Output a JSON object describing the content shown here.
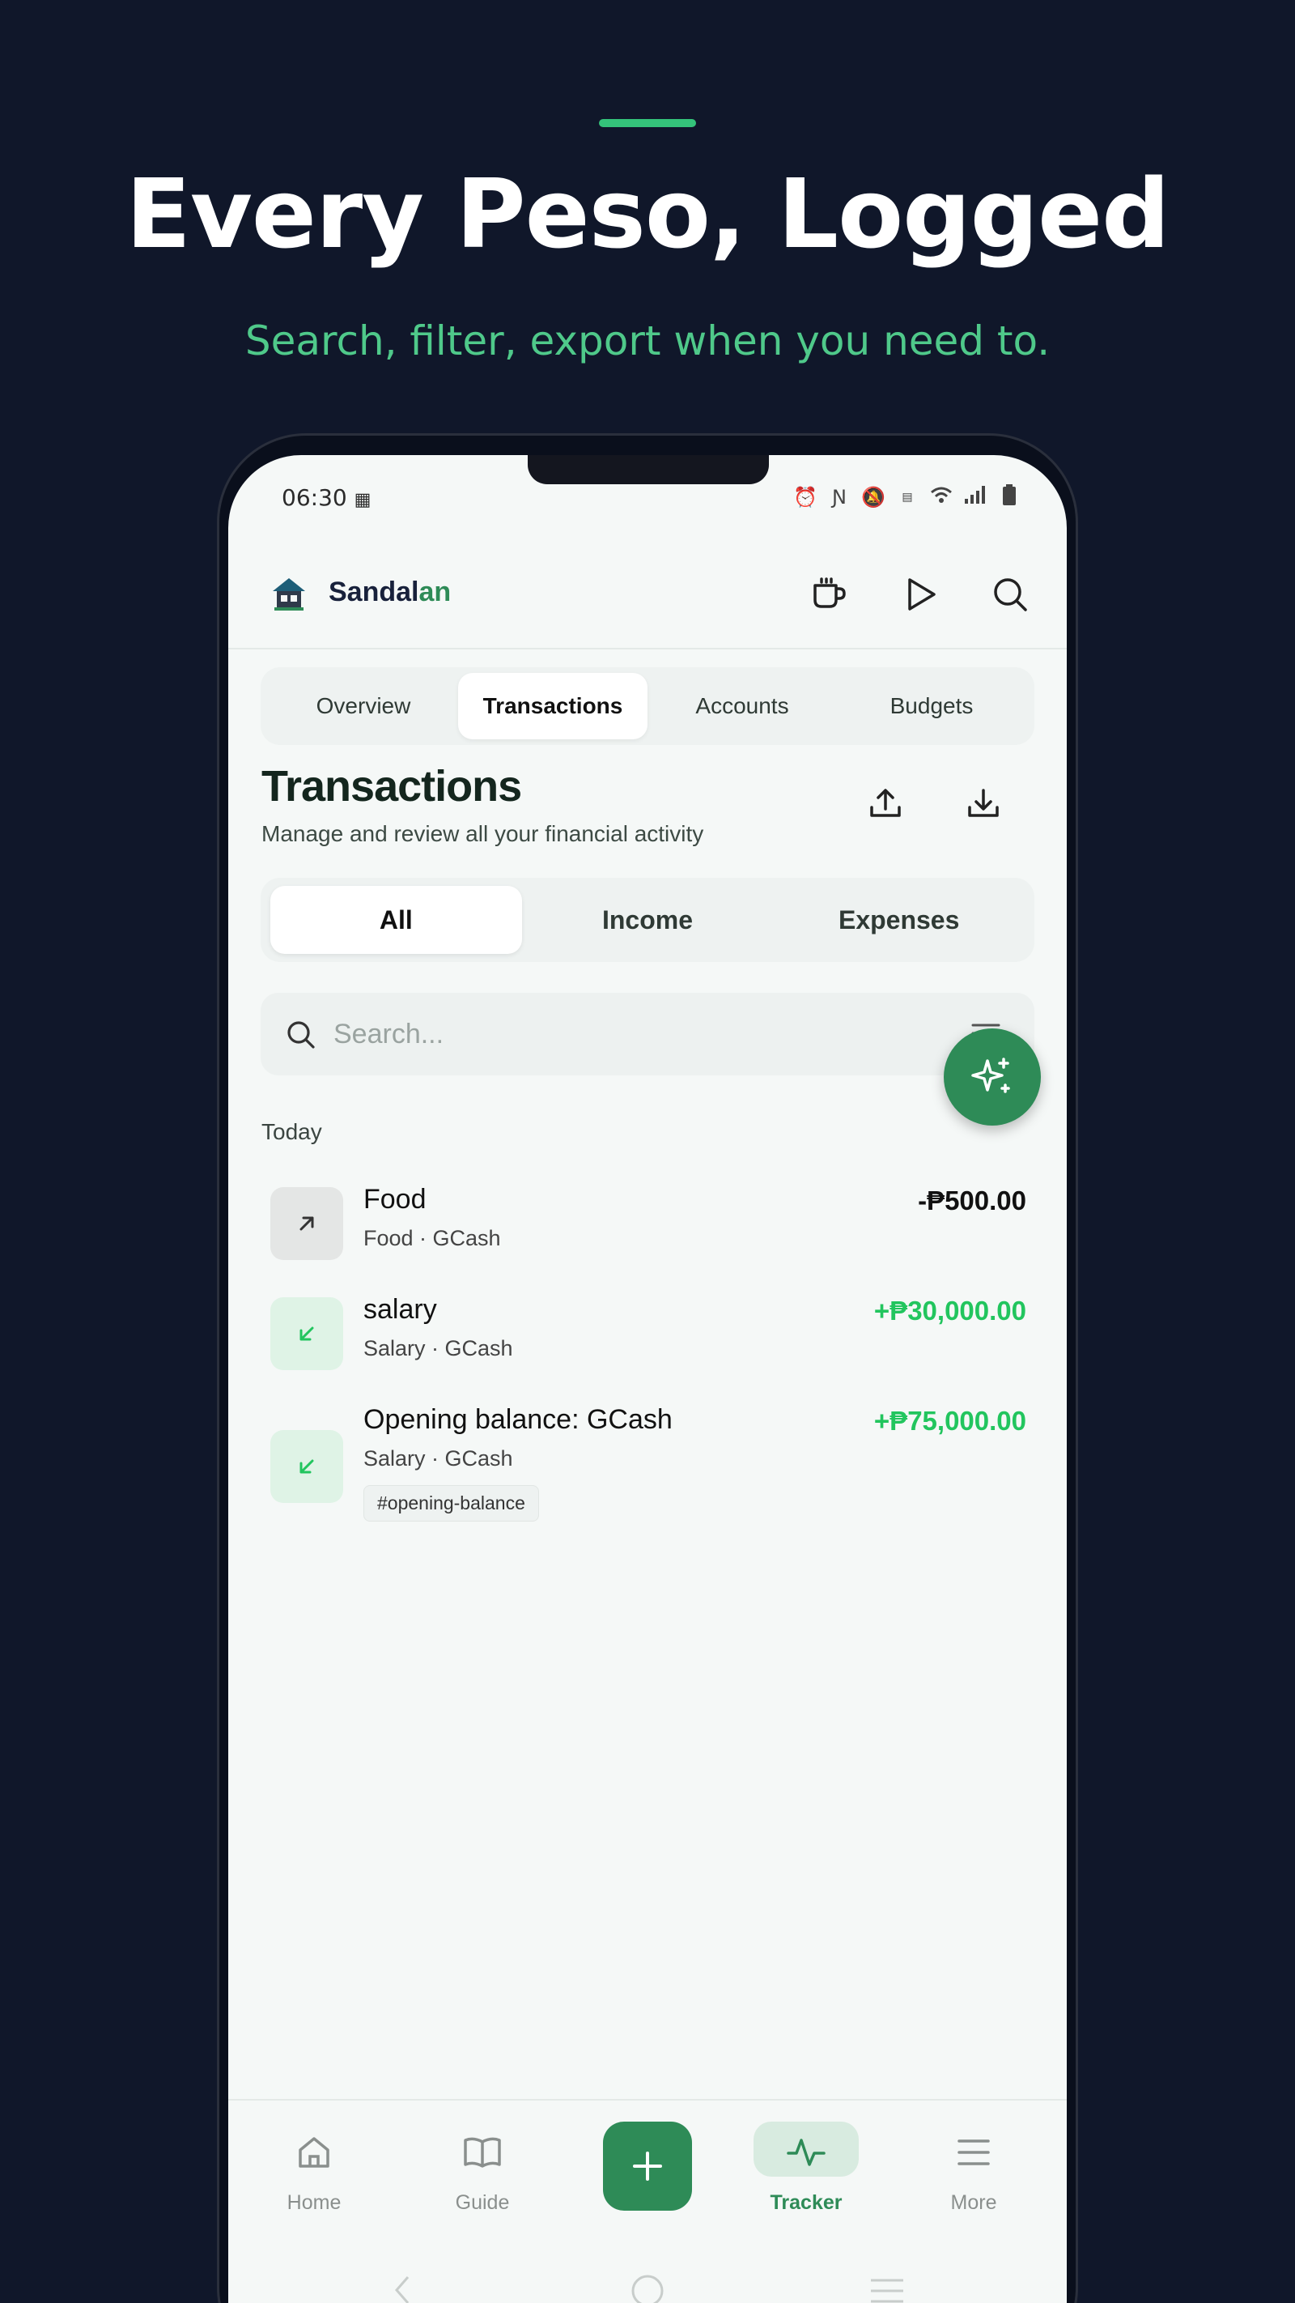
{
  "hero": {
    "title": "Every Peso, Logged",
    "subtitle": "Search, filter, export when you need to."
  },
  "status_bar": {
    "time": "06:30"
  },
  "app": {
    "brand_main": "Sandal",
    "brand_accent": "an"
  },
  "top_tabs": [
    {
      "label": "Overview"
    },
    {
      "label": "Transactions",
      "active": true
    },
    {
      "label": "Accounts"
    },
    {
      "label": "Budgets"
    }
  ],
  "page": {
    "title": "Transactions",
    "subtitle": "Manage and review all your financial activity"
  },
  "filter_tabs": [
    {
      "label": "All",
      "active": true
    },
    {
      "label": "Income"
    },
    {
      "label": "Expenses"
    }
  ],
  "search": {
    "placeholder": "Search...",
    "value": ""
  },
  "section_label": "Today",
  "transactions": [
    {
      "title": "Food",
      "meta": "Food · GCash",
      "amount": "-₱500.00",
      "type": "expense"
    },
    {
      "title": "salary",
      "meta": "Salary · GCash",
      "amount": "+₱30,000.00",
      "type": "income"
    },
    {
      "title": "Opening balance: GCash",
      "meta": "Salary · GCash",
      "amount": "+₱75,000.00",
      "type": "income",
      "tag": "#opening-balance"
    }
  ],
  "bottom_nav": [
    {
      "label": "Home"
    },
    {
      "label": "Guide"
    },
    {
      "label": "Tracker",
      "active": true
    },
    {
      "label": "More"
    }
  ],
  "colors": {
    "background": "#10172a",
    "accent": "#2e8b57",
    "income": "#22c55e",
    "expense": "#111111"
  }
}
